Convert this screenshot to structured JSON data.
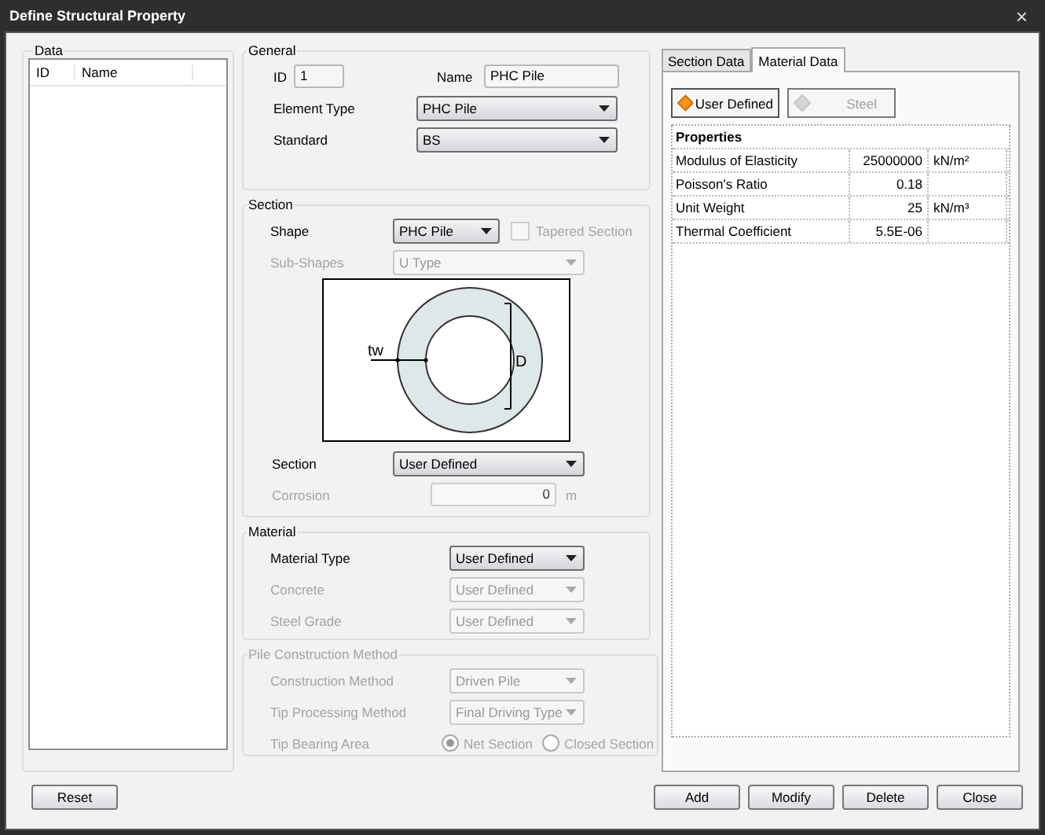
{
  "window": {
    "title": "Define Structural Property",
    "close": "×"
  },
  "data_group": {
    "title": "Data",
    "columns": [
      "ID",
      "Name"
    ]
  },
  "general": {
    "title": "General",
    "id": {
      "label": "ID",
      "value": "1"
    },
    "name": {
      "label": "Name",
      "value": "PHC Pile"
    },
    "rows": [
      {
        "label": "Element Type",
        "value": "PHC Pile",
        "disabled": false
      },
      {
        "label": "Standard",
        "value": "BS",
        "disabled": false
      }
    ]
  },
  "section": {
    "title": "Section",
    "shape": {
      "label": "Shape",
      "value": "PHC Pile",
      "disabled": false
    },
    "tapered": {
      "label": "Tapered Section",
      "checked": false,
      "disabled": true
    },
    "sub_shapes": {
      "label": "Sub-Shapes",
      "value": "U Type",
      "disabled": true
    },
    "diagram": {
      "thickness_label": "tw",
      "diameter_label": "D"
    },
    "section_type": {
      "label": "Section",
      "value": "User Defined",
      "disabled": false
    },
    "corrosion": {
      "label": "Corrosion",
      "value": "0",
      "unit": "m",
      "disabled": true
    }
  },
  "material": {
    "title": "Material",
    "rows": [
      {
        "label": "Material Type",
        "value": "User Defined",
        "disabled": false
      },
      {
        "label": "Concrete",
        "value": "User Defined",
        "disabled": true
      },
      {
        "label": "Steel Grade",
        "value": "User Defined",
        "disabled": true
      }
    ]
  },
  "pile": {
    "title": "Pile Construction Method",
    "disabled": true,
    "rows": [
      {
        "label": "Construction Method",
        "value": "Driven Pile"
      },
      {
        "label": "Tip Processing Method",
        "value": "Final Driving Type"
      }
    ],
    "tip_bearing": {
      "label": "Tip Bearing Area",
      "options": [
        {
          "label": "Net Section",
          "selected": true
        },
        {
          "label": "Closed Section",
          "selected": false
        }
      ]
    }
  },
  "tabs": [
    {
      "label": "Section Data",
      "selected": false
    },
    {
      "label": "Material Data",
      "selected": true
    }
  ],
  "material_buttons": [
    {
      "label": "User Defined",
      "selected": true
    },
    {
      "label": "Steel",
      "selected": false
    }
  ],
  "properties": {
    "header": "Properties",
    "rows": [
      {
        "name": "Modulus of Elasticity",
        "value": "25000000",
        "unit": "kN/m²"
      },
      {
        "name": "Poisson's Ratio",
        "value": "0.18",
        "unit": ""
      },
      {
        "name": "Unit Weight",
        "value": "25",
        "unit": "kN/m³"
      },
      {
        "name": "Thermal Coefficient",
        "value": "5.5E-06",
        "unit": ""
      }
    ]
  },
  "buttons_left": [
    "Reset"
  ],
  "buttons_right": [
    "Add",
    "Modify",
    "Delete",
    "Close"
  ]
}
